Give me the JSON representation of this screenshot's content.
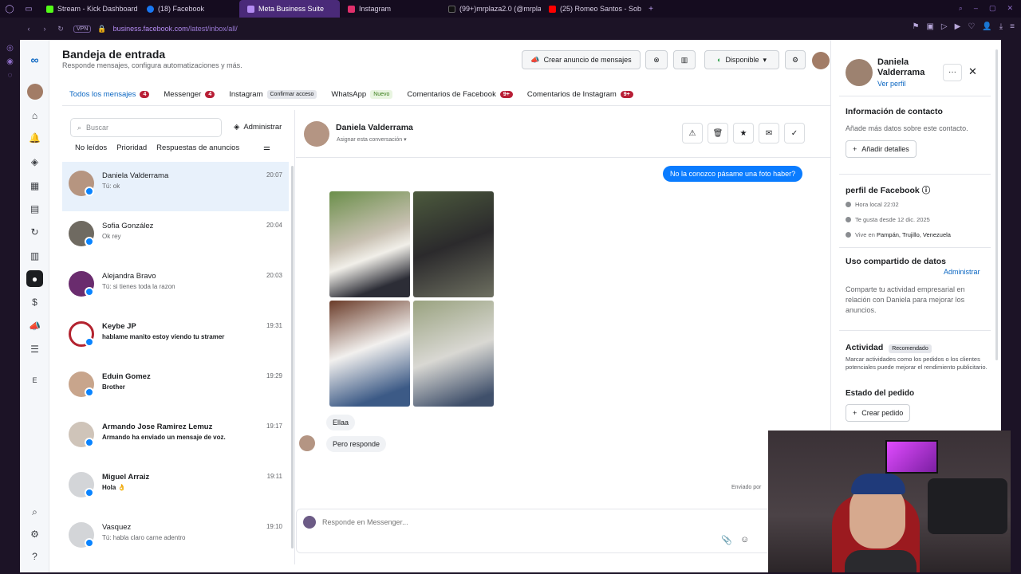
{
  "browser": {
    "tabs": [
      {
        "label": "Stream - Kick Dashboard",
        "color": "#53fc18"
      },
      {
        "label": "(18) Facebook",
        "color": "#1877f2"
      },
      {
        "label": "Meta Business Suite",
        "color": "#b48cf3"
      },
      {
        "label": "Instagram",
        "color": "#e1306c"
      },
      {
        "label": "(99+)mrplaza2.0 (@mrpla",
        "color": "#111111"
      },
      {
        "label": "(25) Romeo Santos - Sobr",
        "color": "#ff0000"
      }
    ],
    "new_tab": "+",
    "vpn": "VPN",
    "url_host": "business.facebook.com",
    "url_path": "/latest/inbox/all/"
  },
  "header": {
    "title": "Bandeja de entrada",
    "subtitle": "Responde mensajes, configura automatizaciones y más.",
    "create_ad": "Crear anuncio de mensajes",
    "status": "Disponible"
  },
  "tabs": [
    {
      "label": "Todos los mensajes",
      "count": "4"
    },
    {
      "label": "Messenger",
      "count": "4"
    },
    {
      "label": "Instagram",
      "pill": "Confirmar acceso"
    },
    {
      "label": "WhatsApp",
      "pill": "Nuevo"
    },
    {
      "label": "Comentarios de Facebook",
      "count": "9+"
    },
    {
      "label": "Comentarios de Instagram",
      "count": "9+"
    }
  ],
  "list": {
    "search_placeholder": "Buscar",
    "admin": "Administrar",
    "filters": [
      "No leídos",
      "Prioridad",
      "Respuestas de anuncios"
    ],
    "conversations": [
      {
        "name": "Daniela Valderrama",
        "preview": "Tú: ok",
        "time": "20:07"
      },
      {
        "name": "Sofia González",
        "preview": "Ok rey",
        "time": "20:04"
      },
      {
        "name": "Alejandra Bravo",
        "preview": "Tú: si tienes toda la razon",
        "time": "20:03"
      },
      {
        "name": "Keybe JP",
        "preview": "hablame manito estoy viendo tu stramer",
        "time": "19:31"
      },
      {
        "name": "Eduin Gomez",
        "preview": "Brother",
        "time": "19:29"
      },
      {
        "name": "Armando Jose Ramirez Lemuz",
        "preview": "Armando ha enviado un mensaje de voz.",
        "time": "19:17"
      },
      {
        "name": "Miguel Arraiz",
        "preview": "Hola 👌",
        "time": "19:11"
      },
      {
        "name": "Vasquez",
        "preview": "Tú: habla claro carne adentro",
        "time": "19:10"
      }
    ]
  },
  "chat": {
    "name": "Daniela Valderrama",
    "assign": "Asignar esta conversación",
    "outgoing": "No la conozco pásame una foto haber?",
    "incoming": [
      "Ellaa",
      "Pero responde"
    ],
    "sent_label": "Enviado por",
    "composer_placeholder": "Responde en Messenger..."
  },
  "side": {
    "name": "Daniela Valderrama",
    "view_profile": "Ver perfil",
    "contact_title": "Información de contacto",
    "contact_text": "Añade más datos sobre este contacto.",
    "add_details": "Añadir detalles",
    "fb_profile": "perfil de Facebook",
    "local_time": "Hora local 22:02",
    "likes_since": "Te gusta desde 12 dic. 2025",
    "lives_in_prefix": "Vive en",
    "lives_in": "Pampán, Trujillo, Venezuela",
    "data_title": "Uso compartido de datos",
    "data_admin": "Administrar",
    "data_text": "Comparte tu actividad empresarial en relación con Daniela para mejorar los anuncios.",
    "activity_title": "Actividad",
    "activity_pill": "Recomendado",
    "activity_text": "Marcar actividades como los pedidos o los clientes potenciales puede mejorar el rendimiento publicitario.",
    "order_title": "Estado del pedido",
    "create_order": "Crear pedido"
  },
  "rail": {
    "letter": "E"
  },
  "colors": {
    "accent": "#0a66c2",
    "badge": "#b81f36",
    "bubble": "#0a7cff"
  }
}
